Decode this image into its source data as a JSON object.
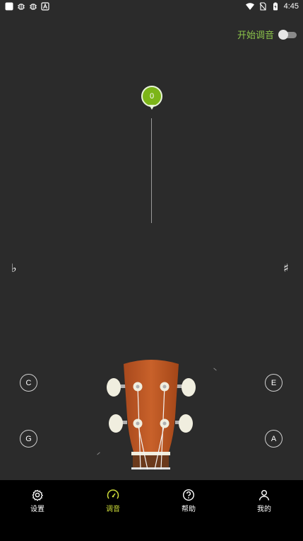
{
  "status_bar": {
    "time": "4:45",
    "left_icons": [
      "app-icon",
      "bug-icon",
      "bug-icon",
      "keyboard-a-icon"
    ],
    "right_icons": [
      "wifi-icon",
      "no-sim-icon",
      "battery-charging-icon"
    ]
  },
  "tuner": {
    "toggle_label": "开始调音",
    "toggle_on": false,
    "cents_value": "0",
    "flat_symbol": "♭",
    "sharp_symbol": "♯",
    "accent_color": "#7cb518"
  },
  "strings": {
    "c": "C",
    "g": "G",
    "e": "E",
    "a": "A"
  },
  "bottom_nav": {
    "items": [
      {
        "label": "设置",
        "icon": "settings-icon",
        "active": false
      },
      {
        "label": "调音",
        "icon": "gauge-icon",
        "active": true
      },
      {
        "label": "帮助",
        "icon": "help-icon",
        "active": false
      },
      {
        "label": "我的",
        "icon": "profile-icon",
        "active": false
      }
    ],
    "active_color": "#cddc39"
  }
}
